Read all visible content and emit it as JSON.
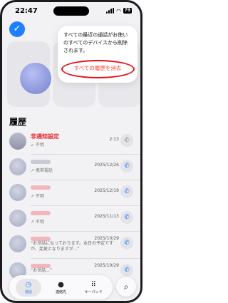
{
  "status_bar": {
    "time": "22:47",
    "battery": "79"
  },
  "favorites": {
    "select_icon": "checkmark-icon"
  },
  "popup": {
    "message": "すべての最近の通話がお使いのすべてのデバイスから削除されます。",
    "clear_all_label": "すべての履歴を消去"
  },
  "history": {
    "title": "履歴",
    "rows": [
      {
        "name": "非通知設定",
        "sub": "↙ 不明",
        "date": "2:13",
        "missed": true
      },
      {
        "name": "",
        "sub": "↗ 携帯電話",
        "date": "2025/12/26",
        "missed": false
      },
      {
        "name": "",
        "sub": "↗ 不明",
        "date": "2025/12/19",
        "missed": false
      },
      {
        "name": "",
        "sub": "↗ 不明",
        "date": "2025/11/13",
        "missed": false
      },
      {
        "name": "",
        "sub": "“お世話になっております。本日の予定ですが、変更となりますが...”",
        "date": "2025/10/29",
        "missed": false
      },
      {
        "name": "",
        "sub": "“お世話...”",
        "date": "2025/10/29",
        "missed": false
      }
    ]
  },
  "tabbar": {
    "tabs": [
      {
        "label": "通話",
        "icon": "clock-icon"
      },
      {
        "label": "連絡先",
        "icon": "person-icon"
      },
      {
        "label": "キーパッド",
        "icon": "keypad-icon"
      }
    ],
    "search_icon": "search-icon"
  },
  "colors": {
    "accent": "#1f80ff",
    "destructive": "#ff3b30",
    "annotation": "#e8101a"
  }
}
